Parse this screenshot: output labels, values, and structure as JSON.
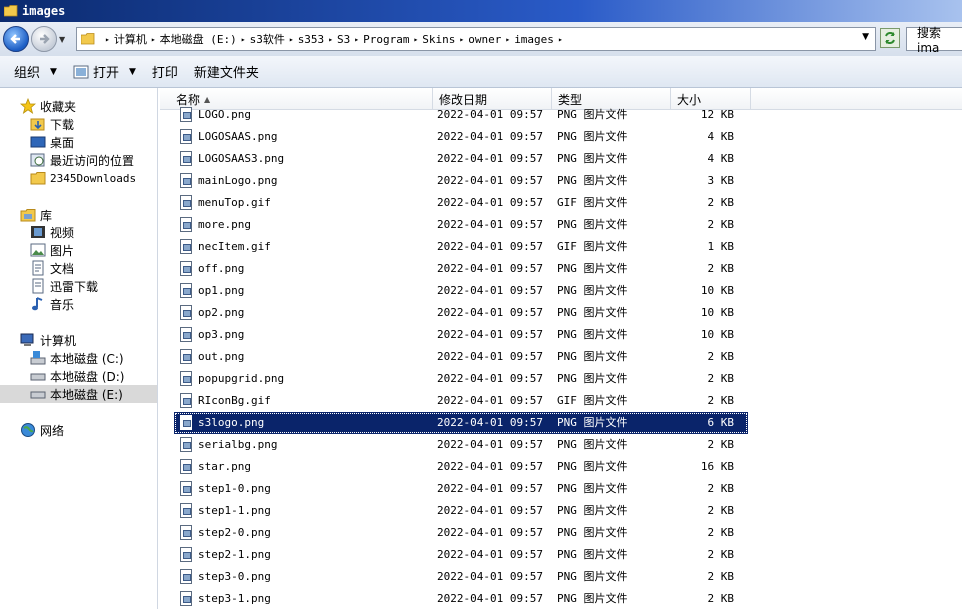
{
  "window": {
    "title": "images"
  },
  "address": {
    "crumbs": [
      "计算机",
      "本地磁盘 (E:)",
      "s3软件",
      "s353",
      "S3",
      "Program",
      "Skins",
      "owner",
      "images"
    ]
  },
  "search": {
    "label": "搜索 ima"
  },
  "toolbar": {
    "organize": "组织",
    "open": "打开",
    "print": "打印",
    "new_folder": "新建文件夹"
  },
  "sidebar": {
    "favorites": {
      "label": "收藏夹",
      "items": [
        "下载",
        "桌面",
        "最近访问的位置",
        "2345Downloads"
      ]
    },
    "libraries": {
      "label": "库",
      "items": [
        "视频",
        "图片",
        "文档",
        "迅雷下载",
        "音乐"
      ]
    },
    "computer": {
      "label": "计算机",
      "items": [
        "本地磁盘 (C:)",
        "本地磁盘 (D:)",
        "本地磁盘 (E:)"
      ]
    },
    "network": {
      "label": "网络"
    }
  },
  "columns": {
    "name": "名称",
    "date": "修改日期",
    "type": "类型",
    "size": "大小"
  },
  "files": [
    {
      "name": "LOGO.png",
      "date": "2022-04-01 09:57",
      "type": "PNG 图片文件",
      "size": "12 KB"
    },
    {
      "name": "LOGOSAAS.png",
      "date": "2022-04-01 09:57",
      "type": "PNG 图片文件",
      "size": "4 KB"
    },
    {
      "name": "LOGOSAAS3.png",
      "date": "2022-04-01 09:57",
      "type": "PNG 图片文件",
      "size": "4 KB"
    },
    {
      "name": "mainLogo.png",
      "date": "2022-04-01 09:57",
      "type": "PNG 图片文件",
      "size": "3 KB"
    },
    {
      "name": "menuTop.gif",
      "date": "2022-04-01 09:57",
      "type": "GIF 图片文件",
      "size": "2 KB"
    },
    {
      "name": "more.png",
      "date": "2022-04-01 09:57",
      "type": "PNG 图片文件",
      "size": "2 KB"
    },
    {
      "name": "necItem.gif",
      "date": "2022-04-01 09:57",
      "type": "GIF 图片文件",
      "size": "1 KB"
    },
    {
      "name": "off.png",
      "date": "2022-04-01 09:57",
      "type": "PNG 图片文件",
      "size": "2 KB"
    },
    {
      "name": "op1.png",
      "date": "2022-04-01 09:57",
      "type": "PNG 图片文件",
      "size": "10 KB"
    },
    {
      "name": "op2.png",
      "date": "2022-04-01 09:57",
      "type": "PNG 图片文件",
      "size": "10 KB"
    },
    {
      "name": "op3.png",
      "date": "2022-04-01 09:57",
      "type": "PNG 图片文件",
      "size": "10 KB"
    },
    {
      "name": "out.png",
      "date": "2022-04-01 09:57",
      "type": "PNG 图片文件",
      "size": "2 KB"
    },
    {
      "name": "popupgrid.png",
      "date": "2022-04-01 09:57",
      "type": "PNG 图片文件",
      "size": "2 KB"
    },
    {
      "name": "RIconBg.gif",
      "date": "2022-04-01 09:57",
      "type": "GIF 图片文件",
      "size": "2 KB"
    },
    {
      "name": "s3logo.png",
      "date": "2022-04-01 09:57",
      "type": "PNG 图片文件",
      "size": "6 KB",
      "selected": true
    },
    {
      "name": "serialbg.png",
      "date": "2022-04-01 09:57",
      "type": "PNG 图片文件",
      "size": "2 KB"
    },
    {
      "name": "star.png",
      "date": "2022-04-01 09:57",
      "type": "PNG 图片文件",
      "size": "16 KB"
    },
    {
      "name": "step1-0.png",
      "date": "2022-04-01 09:57",
      "type": "PNG 图片文件",
      "size": "2 KB"
    },
    {
      "name": "step1-1.png",
      "date": "2022-04-01 09:57",
      "type": "PNG 图片文件",
      "size": "2 KB"
    },
    {
      "name": "step2-0.png",
      "date": "2022-04-01 09:57",
      "type": "PNG 图片文件",
      "size": "2 KB"
    },
    {
      "name": "step2-1.png",
      "date": "2022-04-01 09:57",
      "type": "PNG 图片文件",
      "size": "2 KB"
    },
    {
      "name": "step3-0.png",
      "date": "2022-04-01 09:57",
      "type": "PNG 图片文件",
      "size": "2 KB"
    },
    {
      "name": "step3-1.png",
      "date": "2022-04-01 09:57",
      "type": "PNG 图片文件",
      "size": "2 KB"
    }
  ],
  "colors": {
    "selection": "#0a246a",
    "title_bar": "#0b2a6e"
  }
}
